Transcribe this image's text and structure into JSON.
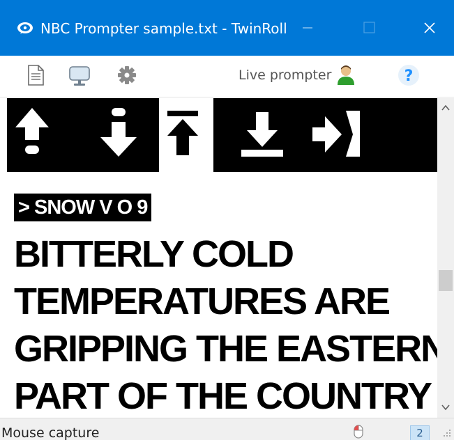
{
  "window": {
    "title": "NBC Prompter sample.txt - TwinRoll",
    "controls": {
      "minimize_icon": "minimize-icon",
      "maximize_icon": "maximize-icon",
      "close_icon": "close-icon"
    }
  },
  "toolbar": {
    "buttons": [
      {
        "icon": "document-icon"
      },
      {
        "icon": "monitor-icon"
      },
      {
        "icon": "gear-icon"
      }
    ],
    "live_label": "Live prompter",
    "live_icon": "user-icon",
    "help_label": "?"
  },
  "navigation": {
    "buttons": [
      {
        "icon": "arrow-up-icon"
      },
      {
        "icon": "arrow-down-icon"
      },
      {
        "icon": "jump-to-top-icon",
        "selected": true
      },
      {
        "icon": "jump-to-bottom-icon"
      },
      {
        "icon": "exit-icon"
      }
    ]
  },
  "script": {
    "cue": "> SNOW V O 9",
    "lines": [
      "BITTERLY COLD",
      "TEMPERATURES ARE",
      "GRIPPING THE EASTERN",
      "PART OF THE COUNTRY"
    ]
  },
  "statusbar": {
    "text": "Mouse capture",
    "mouse_icon": "mouse-icon",
    "page_number": "2",
    "grip_icon": "resize-grip-icon"
  },
  "colors": {
    "titlebar": "#0078d7",
    "accent_help": "#1e90ff",
    "user_icon_green": "#2e9e2e",
    "page_badge_bg": "#cce4f7"
  }
}
